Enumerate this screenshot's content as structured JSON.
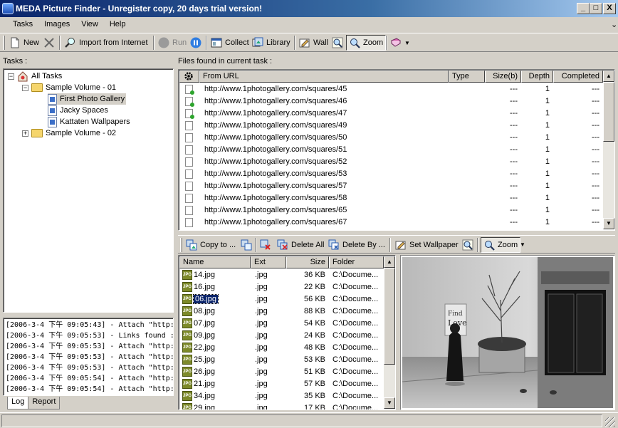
{
  "window": {
    "title": "MEDA Picture Finder - Unregister copy, 20 days trial version!",
    "minimize": "_",
    "maximize": "□",
    "close": "X"
  },
  "menu": [
    "Tasks",
    "Images",
    "View",
    "Help"
  ],
  "menu_chevron": "⌄",
  "toolbar": {
    "new": "New",
    "import": "Import from Internet",
    "run": "Run",
    "collect": "Collect",
    "library": "Library",
    "wall": "Wall",
    "zoom": "Zoom"
  },
  "tasks_label": "Tasks :",
  "tree": {
    "root": "All Tasks",
    "vol1": "Sample Volume - 01",
    "item1": "First Photo Gallery",
    "item2": "Jacky Spaces",
    "item3": "Kattaten Wallpapers",
    "vol2": "Sample Volume - 02"
  },
  "log": [
    "[2006-3-4 下午 09:05:43] - Attach \"http:",
    "[2006-3-4 下午 09:05:53] - Links found :",
    "[2006-3-4 下午 09:05:53] - Attach \"http:",
    "[2006-3-4 下午 09:05:53] - Attach \"http:",
    "[2006-3-4 下午 09:05:53] - Attach \"http:",
    "[2006-3-4 下午 09:05:54] - Attach \"http:",
    "[2006-3-4 下午 09:05:54] - Attach \"http:"
  ],
  "log_tabs": [
    "Log",
    "Report"
  ],
  "files_label": "Files found in current task :",
  "url_columns": [
    "From URL",
    "Type",
    "Size(b)",
    "Depth",
    "Completed"
  ],
  "urls": [
    {
      "url": "http://www.1photogallery.com/squares/45",
      "size": "---",
      "depth": "1",
      "completed": "---",
      "done": true
    },
    {
      "url": "http://www.1photogallery.com/squares/46",
      "size": "---",
      "depth": "1",
      "completed": "---",
      "done": true
    },
    {
      "url": "http://www.1photogallery.com/squares/47",
      "size": "---",
      "depth": "1",
      "completed": "---",
      "done": true
    },
    {
      "url": "http://www.1photogallery.com/squares/49",
      "size": "---",
      "depth": "1",
      "completed": "---",
      "done": false
    },
    {
      "url": "http://www.1photogallery.com/squares/50",
      "size": "---",
      "depth": "1",
      "completed": "---",
      "done": false
    },
    {
      "url": "http://www.1photogallery.com/squares/51",
      "size": "---",
      "depth": "1",
      "completed": "---",
      "done": false
    },
    {
      "url": "http://www.1photogallery.com/squares/52",
      "size": "---",
      "depth": "1",
      "completed": "---",
      "done": false
    },
    {
      "url": "http://www.1photogallery.com/squares/53",
      "size": "---",
      "depth": "1",
      "completed": "---",
      "done": false
    },
    {
      "url": "http://www.1photogallery.com/squares/57",
      "size": "---",
      "depth": "1",
      "completed": "---",
      "done": false
    },
    {
      "url": "http://www.1photogallery.com/squares/58",
      "size": "---",
      "depth": "1",
      "completed": "---",
      "done": false
    },
    {
      "url": "http://www.1photogallery.com/squares/65",
      "size": "---",
      "depth": "1",
      "completed": "---",
      "done": false
    },
    {
      "url": "http://www.1photogallery.com/squares/67",
      "size": "---",
      "depth": "1",
      "completed": "---",
      "done": false
    }
  ],
  "toolbar2": {
    "copy": "Copy to ...",
    "delete_all": "Delete All",
    "delete_by": "Delete By ...",
    "wallpaper": "Set Wallpaper",
    "zoom": "Zoom"
  },
  "file_columns": [
    "Name",
    "Ext",
    "Size",
    "Folder"
  ],
  "jpg_badge": "JPG",
  "files": [
    {
      "name": "14.jpg",
      "ext": ".jpg",
      "size": "36 KB",
      "folder": "C:\\Docume..."
    },
    {
      "name": "16.jpg",
      "ext": ".jpg",
      "size": "22 KB",
      "folder": "C:\\Docume..."
    },
    {
      "name": "06.jpg",
      "ext": ".jpg",
      "size": "56 KB",
      "folder": "C:\\Docume...",
      "selected": true
    },
    {
      "name": "08.jpg",
      "ext": ".jpg",
      "size": "88 KB",
      "folder": "C:\\Docume..."
    },
    {
      "name": "07.jpg",
      "ext": ".jpg",
      "size": "54 KB",
      "folder": "C:\\Docume..."
    },
    {
      "name": "09.jpg",
      "ext": ".jpg",
      "size": "24 KB",
      "folder": "C:\\Docume..."
    },
    {
      "name": "22.jpg",
      "ext": ".jpg",
      "size": "48 KB",
      "folder": "C:\\Docume..."
    },
    {
      "name": "25.jpg",
      "ext": ".jpg",
      "size": "53 KB",
      "folder": "C:\\Docume..."
    },
    {
      "name": "26.jpg",
      "ext": ".jpg",
      "size": "51 KB",
      "folder": "C:\\Docume..."
    },
    {
      "name": "21.jpg",
      "ext": ".jpg",
      "size": "57 KB",
      "folder": "C:\\Docume..."
    },
    {
      "name": "34.jpg",
      "ext": ".jpg",
      "size": "35 KB",
      "folder": "C:\\Docume..."
    },
    {
      "name": "29.jpg",
      "ext": ".jpg",
      "size": "17 KB",
      "folder": "C:\\Docume..."
    }
  ],
  "preview": {
    "sign_line1": "Find",
    "sign_line2": "Love"
  }
}
